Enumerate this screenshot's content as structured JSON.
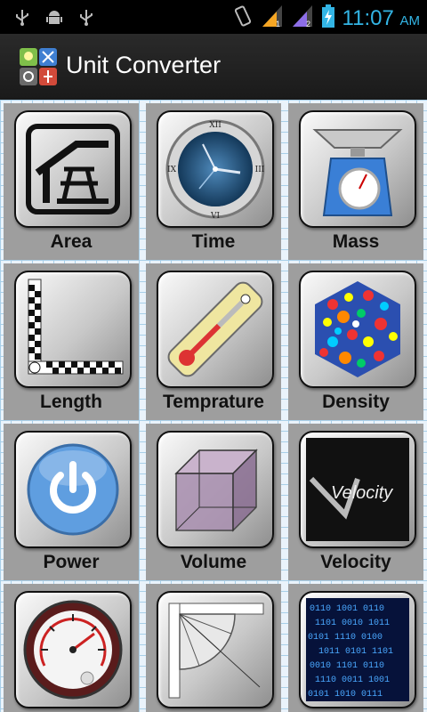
{
  "status_bar": {
    "time": "11:07",
    "ampm": "AM",
    "icons": [
      "usb-icon",
      "android-debug-icon",
      "usb-icon",
      "vibrate-icon",
      "signal-sim1-icon",
      "signal-sim2-icon",
      "battery-charging-icon"
    ]
  },
  "action_bar": {
    "title": "Unit Converter",
    "icon": "unit-converter-app-icon"
  },
  "tiles": [
    {
      "label": "Area",
      "icon": "picnic-table-icon"
    },
    {
      "label": "Time",
      "icon": "clock-icon"
    },
    {
      "label": "Mass",
      "icon": "scale-icon"
    },
    {
      "label": "Length",
      "icon": "ruler-icon"
    },
    {
      "label": "Temprature",
      "icon": "thermometer-icon"
    },
    {
      "label": "Density",
      "icon": "molecules-icon"
    },
    {
      "label": "Power",
      "icon": "power-icon"
    },
    {
      "label": "Volume",
      "icon": "cube-icon"
    },
    {
      "label": "Velocity",
      "icon": "velocity-logo-icon"
    },
    {
      "label": "",
      "icon": "pressure-gauge-icon"
    },
    {
      "label": "",
      "icon": "protractor-icon"
    },
    {
      "label": "",
      "icon": "binary-data-icon"
    }
  ],
  "velocity_logo_text": "Velocity",
  "colors": {
    "status_time": "#33b5e5",
    "tile_bg": "#9e9e9e",
    "grid_bg": "#eaf3fb"
  }
}
